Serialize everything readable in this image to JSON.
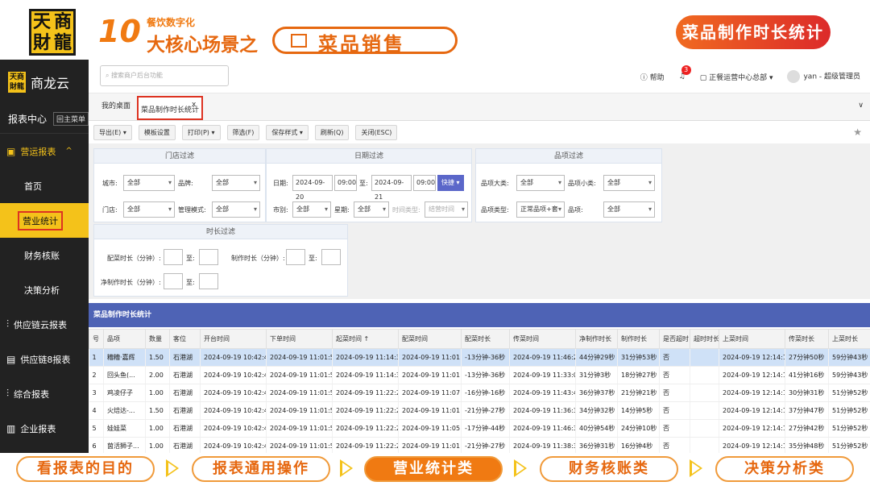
{
  "banner": {
    "logo_chars": [
      "天",
      "商",
      "財",
      "龍"
    ],
    "number": "10",
    "subtitle": "餐饮数字化",
    "headline": "大核心场景之",
    "pill_text": "菜品销售",
    "right_badge": "菜品制作时长统计",
    "accent_color": "#f07a12"
  },
  "sidebar": {
    "brand_mini": "天商財龍",
    "brand": "商龙云",
    "section": "报表中心",
    "back_label": "回主菜单",
    "group_active": "营运报表",
    "items": [
      {
        "label": "首页"
      },
      {
        "label": "营业统计",
        "active": true
      },
      {
        "label": "财务核账"
      },
      {
        "label": "决策分析"
      }
    ],
    "groups": [
      {
        "label": "供应链云报表",
        "icon": "chain-icon"
      },
      {
        "label": "供应链8报表",
        "icon": "report-icon"
      },
      {
        "label": "综合报表",
        "icon": "chain-icon"
      },
      {
        "label": "企业报表",
        "icon": "building-icon"
      }
    ]
  },
  "topbar": {
    "search_placeholder": "搜索商户后台功能",
    "help": "帮助",
    "notify_count": "3",
    "org": "正餐运营中心总部",
    "user": "yan - 超级管理员"
  },
  "tabs": {
    "home": "我的桌面",
    "current": "菜品制作时长统计",
    "close": "x"
  },
  "toolbar": {
    "buttons": [
      "导出(E)",
      "模板设置",
      "打印(P)",
      "筛选(F)",
      "保存样式",
      "刷新(Q)",
      "关闭(ESC)"
    ]
  },
  "filters": {
    "store_title": "门店过滤",
    "date_title": "日期过滤",
    "item_title": "品项过滤",
    "duration_title": "时长过滤",
    "city_label": "城市:",
    "city_value": "全部",
    "brand_label": "品牌:",
    "brand_value": "全部",
    "store_label": "门店:",
    "store_value": "全部",
    "mgmt_label": "管理模式:",
    "mgmt_value": "全部",
    "date_label": "日期:",
    "date_from": "2024-09-20",
    "time_from": "09:00",
    "to_label": "至:",
    "date_to": "2024-09-21",
    "time_to": "09:00",
    "quick": "快捷",
    "shift_label": "市别:",
    "shift_value": "全部",
    "week_label": "星期:",
    "week_value": "全部",
    "time_type_label": "时间类型:",
    "time_type_value": "结营时间",
    "cat_label": "品项大类:",
    "cat_value": "全部",
    "subcat_label": "品项小类:",
    "subcat_value": "全部",
    "type_label": "品项类型:",
    "type_value": "正常品项+套",
    "item_label": "品项:",
    "item_value": "全部",
    "serve_dur_label": "配菜时长（分钟）:",
    "make_dur_label": "制作时长（分钟）:",
    "net_dur_label": "净制作时长（分钟）:",
    "to": "至:"
  },
  "table": {
    "title": "菜品制作时长统计",
    "columns": [
      "号",
      "品项",
      "数量",
      "客位",
      "开台时间",
      "下单时间",
      "起菜时间 ↑",
      "配菜时间",
      "配菜时长",
      "传菜时间",
      "净制作时长",
      "制作时长",
      "是否超时",
      "超时时长",
      "上菜时间",
      "传菜时长",
      "上菜时长"
    ],
    "rows": [
      [
        "1",
        "糟糟·嘉辉",
        "1.50",
        "石港湖",
        "2024-09-19 10:42:49",
        "2024-09-19 11:01:58",
        "2024-09-19 11:14:35",
        "2024-09-19 11:01:59",
        "-13分钟-36秒",
        "2024-09-19 11:46:28",
        "44分钟29秒",
        "31分钟53秒",
        "否",
        "",
        "2024-09-19 12:14:18",
        "27分钟50秒",
        "59分钟43秒"
      ],
      [
        "2",
        "回头鱼(...",
        "2.00",
        "石港湖",
        "2024-09-19 10:42:49",
        "2024-09-19 11:01:58",
        "2024-09-19 11:14:35",
        "2024-09-19 11:01:59",
        "-13分钟-36秒",
        "2024-09-19 11:33:02",
        "31分钟3秒",
        "18分钟27秒",
        "否",
        "",
        "2024-09-19 12:14:18",
        "41分钟16秒",
        "59分钟43秒"
      ],
      [
        "3",
        "鸡凌仔子",
        "1.00",
        "石港湖",
        "2024-09-19 10:42:49",
        "2024-09-19 11:01:58",
        "2024-09-19 11:22:26",
        "2024-09-19 11:07:10",
        "-16分钟-16秒",
        "2024-09-19 11:43:47",
        "36分钟37秒",
        "21分钟21秒",
        "否",
        "",
        "2024-09-19 12:14:18",
        "30分钟31秒",
        "51分钟52秒"
      ],
      [
        "4",
        "火焙达-...",
        "1.50",
        "石港湖",
        "2024-09-19 10:42:49",
        "2024-09-19 11:01:58",
        "2024-09-19 11:22:26",
        "2024-09-19 11:01:59",
        "-21分钟-27秒",
        "2024-09-19 11:36:31",
        "34分钟32秒",
        "14分钟5秒",
        "否",
        "",
        "2024-09-19 12:14:18",
        "37分钟47秒",
        "51分钟52秒"
      ],
      [
        "5",
        "娃娃菜",
        "1.00",
        "石港湖",
        "2024-09-19 10:42:49",
        "2024-09-19 11:01:58",
        "2024-09-19 11:22:26",
        "2024-09-19 11:05:42",
        "-17分钟-44秒",
        "2024-09-19 11:46:36",
        "40分钟54秒",
        "24分钟10秒",
        "否",
        "",
        "2024-09-19 12:14:18",
        "27分钟42秒",
        "51分钟52秒"
      ],
      [
        "6",
        "茵活狮子...",
        "1.00",
        "石港湖",
        "2024-09-19 10:42:49",
        "2024-09-19 11:01:58",
        "2024-09-19 11:22:26",
        "2024-09-19 11:01:59",
        "-21分钟-27秒",
        "2024-09-19 11:38:30",
        "36分钟31秒",
        "16分钟4秒",
        "否",
        "",
        "2024-09-19 12:14:18",
        "35分钟48秒",
        "51分钟52秒"
      ]
    ]
  },
  "steps": [
    "看报表的目的",
    "报表通用操作",
    "营业统计类",
    "财务核账类",
    "决策分析类"
  ]
}
